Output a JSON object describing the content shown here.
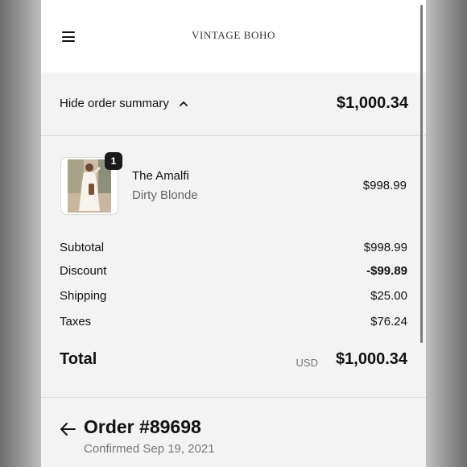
{
  "header": {
    "brand": "VINTAGE BOHO",
    "menu_icon": "hamburger-menu-icon"
  },
  "summary": {
    "toggle_label": "Hide order summary",
    "toggle_icon": "chevron-up-icon",
    "total": "$1,000.34"
  },
  "cart": {
    "items": [
      {
        "name": "The Amalfi",
        "variant": "Dirty Blonde",
        "price": "$998.99",
        "quantity": "1"
      }
    ]
  },
  "totals": {
    "subtotal_label": "Subtotal",
    "subtotal": "$998.99",
    "discount_label": "Discount",
    "discount": "-$99.89",
    "shipping_label": "Shipping",
    "shipping": "$25.00",
    "taxes_label": "Taxes",
    "taxes": "$76.24",
    "total_label": "Total",
    "currency": "USD",
    "total": "$1,000.34"
  },
  "order": {
    "title": "Order #89698",
    "confirmed": "Confirmed Sep 19, 2021",
    "back_icon": "arrow-left-icon"
  },
  "colors": {
    "background": "#f3f3f3",
    "header_bg": "#ffffff",
    "text": "#111111",
    "muted_text": "#777777",
    "badge_bg": "#1a1a1a"
  }
}
